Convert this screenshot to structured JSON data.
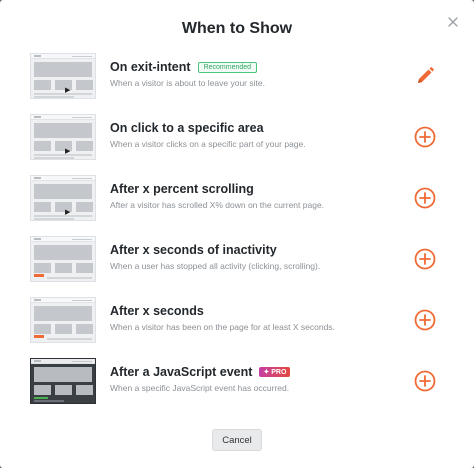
{
  "modal": {
    "title": "When to Show",
    "cancel_label": "Cancel"
  },
  "accent_color": "#f06a35",
  "options": [
    {
      "title": "On exit-intent",
      "badge": "Recommended",
      "description": "When a visitor is about to leave your site.",
      "action_icon": "pencil-icon"
    },
    {
      "title": "On click to a specific area",
      "description": "When a visitor clicks on a specific part of your page.",
      "action_icon": "plus-circle-icon"
    },
    {
      "title": "After x percent scrolling",
      "description": "After a visitor has scrolled X% down on the current page.",
      "action_icon": "plus-circle-icon"
    },
    {
      "title": "After x seconds of inactivity",
      "description": "When a user has stopped all activity (clicking, scrolling).",
      "action_icon": "plus-circle-icon"
    },
    {
      "title": "After x seconds",
      "description": "When a visitor has been on the page for at least X seconds.",
      "action_icon": "plus-circle-icon"
    },
    {
      "title": "After a JavaScript event",
      "badge": "PRO",
      "description": "When a specific JavaScript event has occurred.",
      "action_icon": "plus-circle-icon"
    }
  ]
}
